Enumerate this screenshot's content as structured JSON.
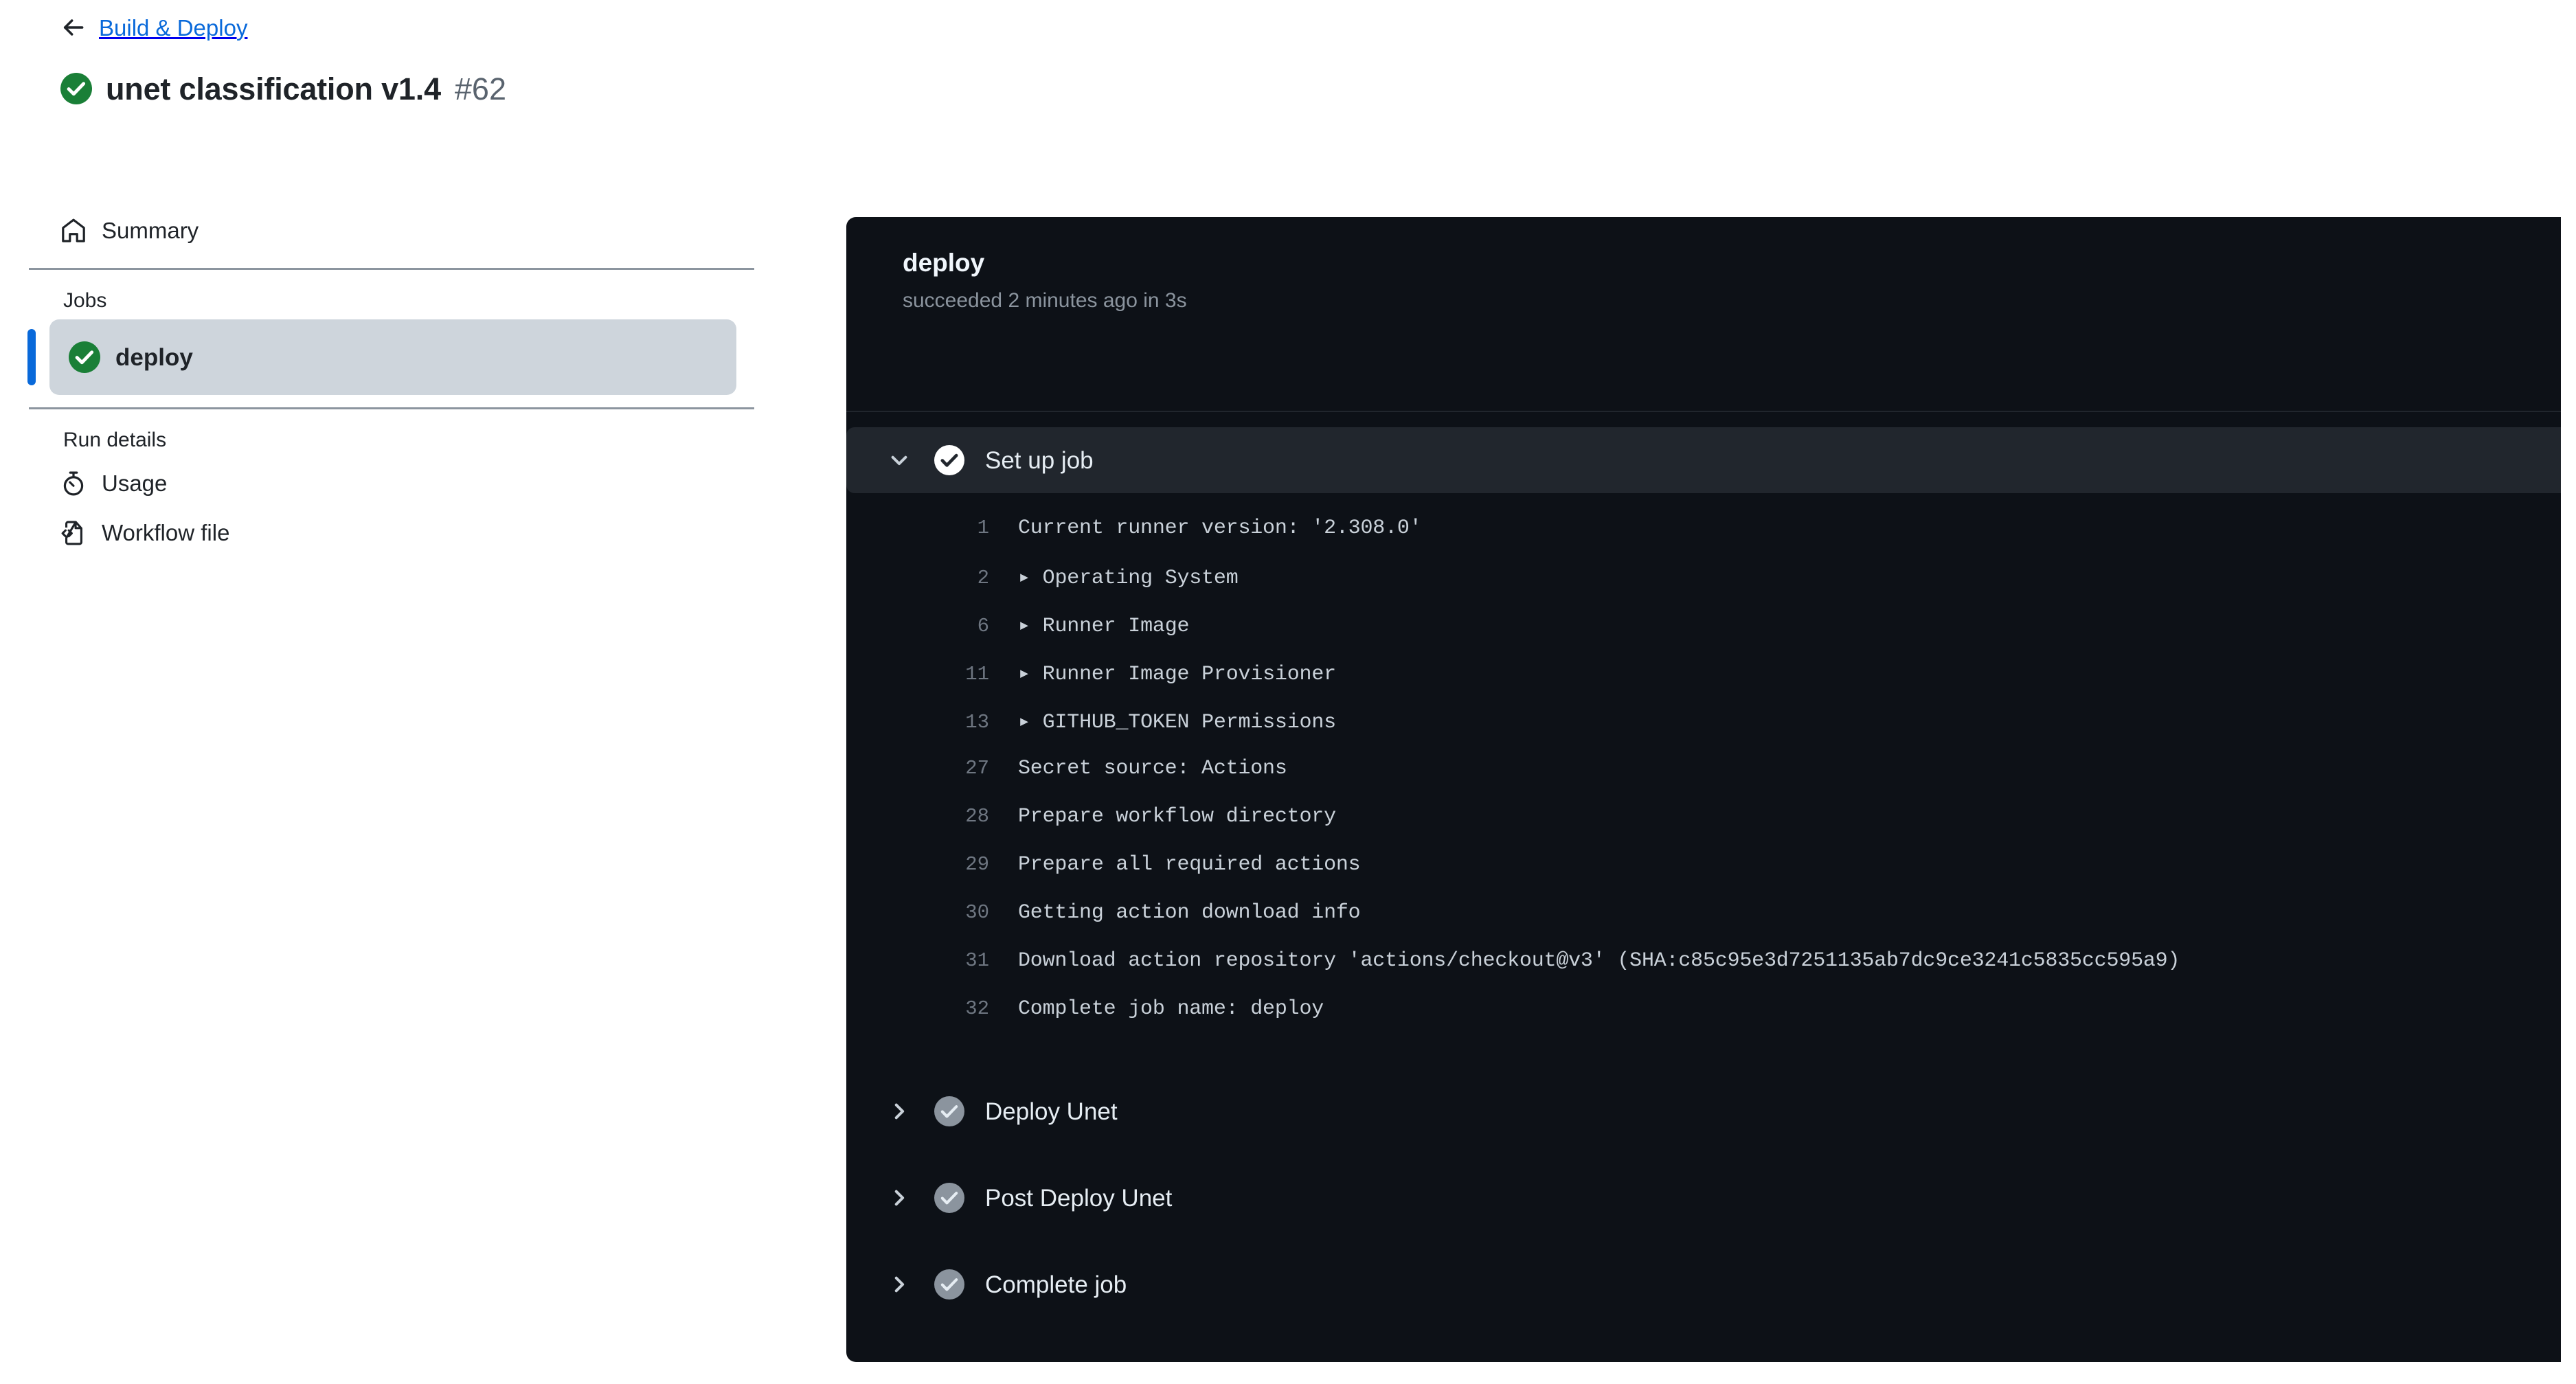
{
  "header": {
    "back_label": "Build & Deploy",
    "back_icon": "arrow-left-icon",
    "run_title": "unet classification v1.4",
    "run_number": "#62",
    "run_status_icon": "check-circle-success-icon"
  },
  "sidebar": {
    "summary": {
      "label": "Summary",
      "icon": "home-icon"
    },
    "jobs_section_label": "Jobs",
    "jobs": [
      {
        "label": "deploy",
        "icon": "check-circle-success-icon",
        "selected": true
      }
    ],
    "run_details_label": "Run details",
    "run_details": [
      {
        "label": "Usage",
        "icon": "stopwatch-icon"
      },
      {
        "label": "Workflow file",
        "icon": "file-code-icon"
      }
    ]
  },
  "log_panel": {
    "job_name": "deploy",
    "job_status": "succeeded 2 minutes ago in 3s",
    "steps": [
      {
        "label": "Set up job",
        "status_icon": "check-circle-white-icon",
        "expanded": true,
        "chevron": "chevron-down-icon",
        "lines": [
          {
            "n": "1",
            "group": false,
            "text": "Current runner version: '2.308.0'"
          },
          {
            "n": "2",
            "group": true,
            "text": "Operating System"
          },
          {
            "n": "6",
            "group": true,
            "text": "Runner Image"
          },
          {
            "n": "11",
            "group": true,
            "text": "Runner Image Provisioner"
          },
          {
            "n": "13",
            "group": true,
            "text": "GITHUB_TOKEN Permissions"
          },
          {
            "n": "27",
            "group": false,
            "text": "Secret source: Actions"
          },
          {
            "n": "28",
            "group": false,
            "text": "Prepare workflow directory"
          },
          {
            "n": "29",
            "group": false,
            "text": "Prepare all required actions"
          },
          {
            "n": "30",
            "group": false,
            "text": "Getting action download info"
          },
          {
            "n": "31",
            "group": false,
            "text": "Download action repository 'actions/checkout@v3' (SHA:c85c95e3d7251135ab7dc9ce3241c5835cc595a9)"
          },
          {
            "n": "32",
            "group": false,
            "text": "Complete job name: deploy"
          }
        ]
      },
      {
        "label": "Deploy Unet",
        "status_icon": "check-circle-grey-icon",
        "expanded": false,
        "chevron": "chevron-right-icon",
        "lines": []
      },
      {
        "label": "Post Deploy Unet",
        "status_icon": "check-circle-grey-icon",
        "expanded": false,
        "chevron": "chevron-right-icon",
        "lines": []
      },
      {
        "label": "Complete job",
        "status_icon": "check-circle-grey-icon",
        "expanded": false,
        "chevron": "chevron-right-icon",
        "lines": []
      }
    ]
  },
  "colors": {
    "success_green": "#1a7f37",
    "link_blue": "#0969da",
    "panel_bg": "#0d1117",
    "step_header_bg": "#21262d",
    "selected_pill": "#ced5dc"
  }
}
